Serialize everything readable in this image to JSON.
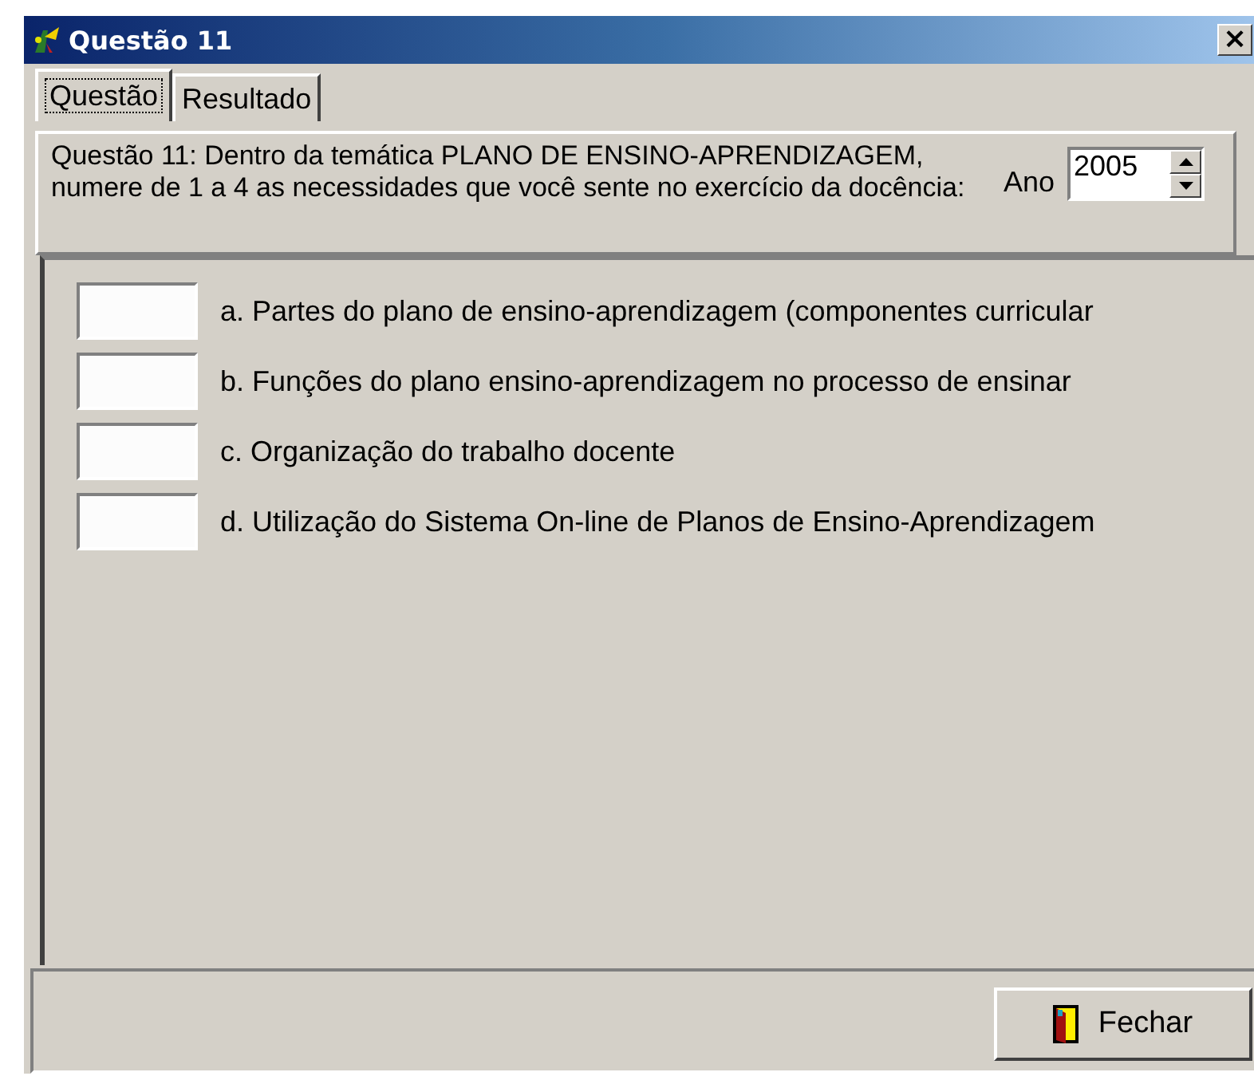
{
  "window": {
    "title": "Questão 11",
    "close": "×"
  },
  "tabs": [
    {
      "label": "Questão",
      "selected": true
    },
    {
      "label": "Resultado",
      "selected": false
    }
  ],
  "question": {
    "text": "Questão 11: Dentro da temática PLANO DE ENSINO-APRENDIZAGEM, numere de 1 a 4 as necessidades que você sente no exercício da docência:",
    "year_label": "Ano",
    "year_value": "2005"
  },
  "items": [
    {
      "label": "a. Partes do plano de ensino-aprendizagem (componentes curricular"
    },
    {
      "label": "b. Funções do plano ensino-aprendizagem no processo de ensinar"
    },
    {
      "label": "c. Organização do trabalho docente"
    },
    {
      "label": "d. Utilização do Sistema On-line de Planos de Ensino-Aprendizagem"
    }
  ],
  "buttons": [
    {
      "label": "Fechar"
    }
  ]
}
